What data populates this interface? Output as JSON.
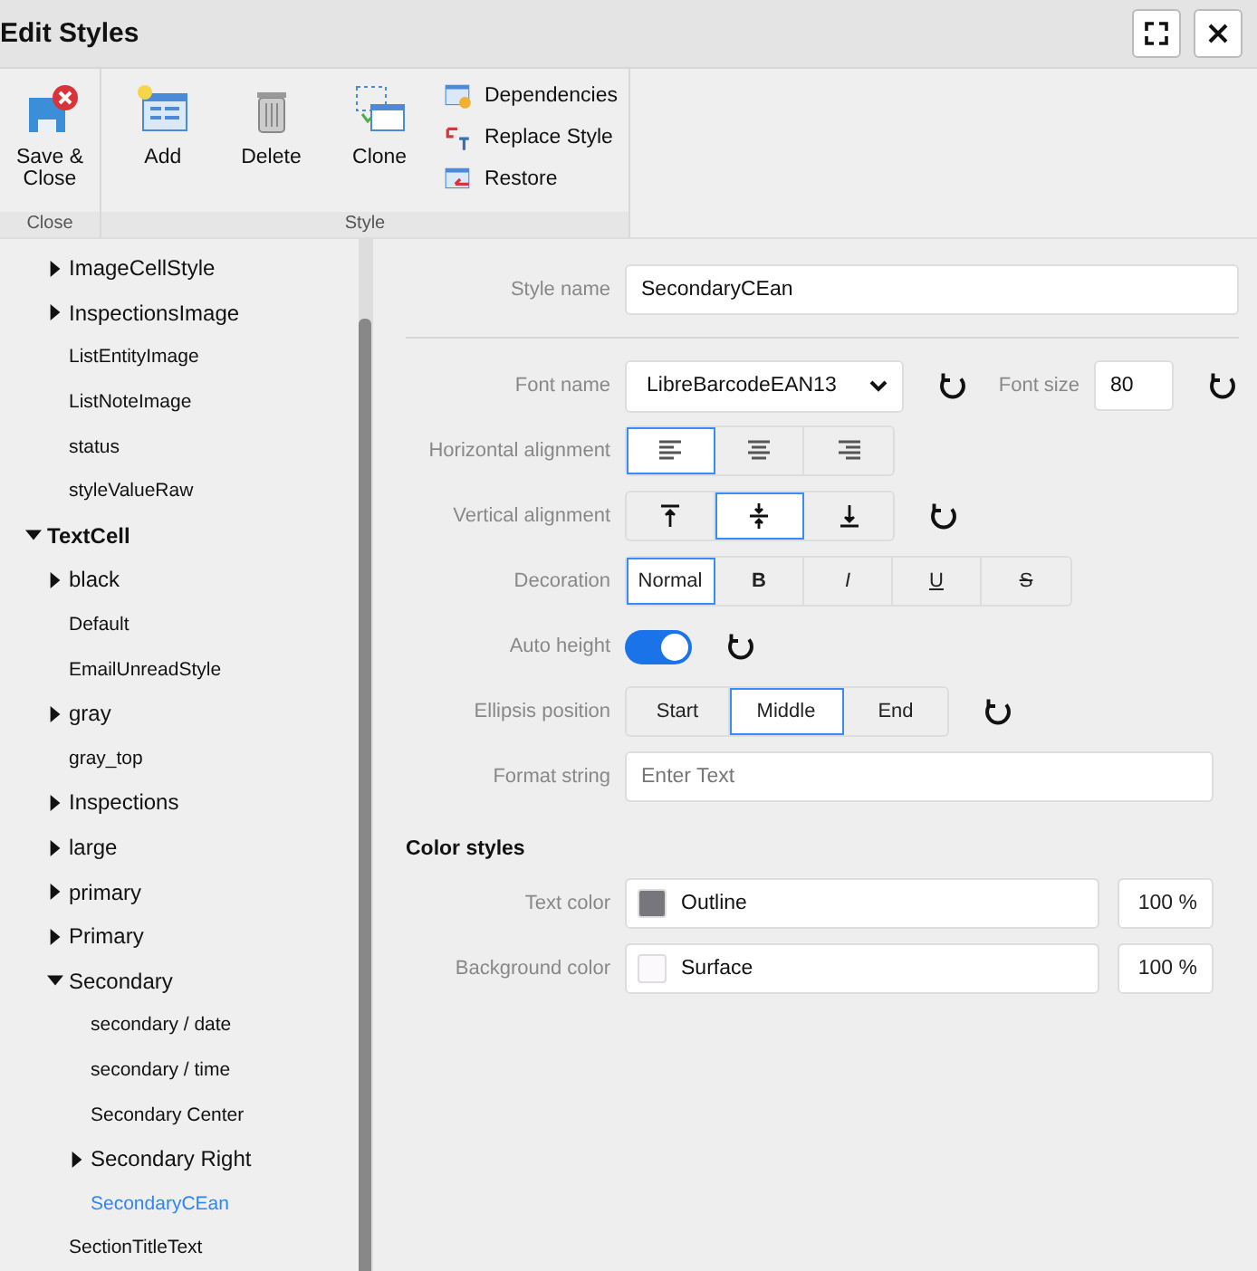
{
  "window": {
    "title": "Edit Styles"
  },
  "toolbar": {
    "groups": [
      {
        "label": "Close",
        "buttons": [
          {
            "label": "Save &\nClose",
            "kind": "save"
          }
        ]
      },
      {
        "label": "Style",
        "buttons": [
          {
            "label": "Add",
            "kind": "add"
          },
          {
            "label": "Delete",
            "kind": "delete"
          },
          {
            "label": "Clone",
            "kind": "clone"
          }
        ],
        "links": [
          {
            "label": "Dependencies",
            "kind": "dependencies"
          },
          {
            "label": "Replace Style",
            "kind": "replace"
          },
          {
            "label": "Restore",
            "kind": "restore"
          }
        ]
      }
    ]
  },
  "tree": [
    {
      "children": [
        {
          "label": "ImageCellStyle",
          "expanded": false,
          "selected": false
        },
        {
          "label": "InspectionsImage",
          "expanded": false,
          "selected": false
        },
        {
          "label": "ListEntityImage",
          "selected": false
        },
        {
          "label": "ListNoteImage",
          "selected": false
        },
        {
          "label": "status",
          "selected": false
        },
        {
          "label": "styleValueRaw",
          "selected": false
        }
      ]
    },
    {
      "label": "TextCell",
      "expanded": true,
      "selected": false,
      "children": [
        {
          "label": "black",
          "expanded": false,
          "selected": false
        },
        {
          "label": "Default",
          "selected": false
        },
        {
          "label": "EmailUnreadStyle",
          "selected": false
        },
        {
          "label": "gray",
          "expanded": false,
          "selected": false
        },
        {
          "label": "gray_top",
          "selected": false
        },
        {
          "label": "Inspections",
          "expanded": false,
          "selected": false
        },
        {
          "label": "large",
          "expanded": false,
          "selected": false
        },
        {
          "label": "primary",
          "expanded": false,
          "selected": false
        },
        {
          "label": "Primary",
          "expanded": false,
          "selected": false
        },
        {
          "label": "Secondary",
          "expanded": true,
          "selected": false,
          "children": [
            {
              "label": "secondary / date",
              "selected": false
            },
            {
              "label": "secondary / time",
              "selected": false
            },
            {
              "label": "Secondary Center",
              "selected": false
            },
            {
              "label": "Secondary Right",
              "expanded": false,
              "selected": false
            },
            {
              "label": "SecondaryCEan",
              "selected": true
            }
          ]
        },
        {
          "label": "SectionTitleText",
          "selected": false
        }
      ]
    }
  ],
  "form": {
    "style_name": {
      "label": "Style name",
      "value": "SecondaryCEan"
    },
    "font_name": {
      "label": "Font name",
      "value": "LibreBarcodeEAN13"
    },
    "font_size": {
      "label": "Font size",
      "value": "80"
    },
    "horizontal_alignment": {
      "label": "Horizontal alignment",
      "options": [
        {
          "kind": "left",
          "selected": true
        },
        {
          "kind": "center",
          "selected": false
        },
        {
          "kind": "right",
          "selected": false
        }
      ]
    },
    "vertical_alignment": {
      "label": "Vertical alignment",
      "options": [
        {
          "kind": "top",
          "selected": false
        },
        {
          "kind": "middle",
          "selected": true
        },
        {
          "kind": "bottom",
          "selected": false
        }
      ]
    },
    "decoration": {
      "label": "Decoration",
      "options": [
        {
          "label": "Normal",
          "kind": "normal",
          "selected": true
        },
        {
          "label": "B",
          "kind": "bold",
          "selected": false
        },
        {
          "label": "I",
          "kind": "italic",
          "selected": false
        },
        {
          "label": "U",
          "kind": "underline",
          "selected": false
        },
        {
          "label": "S",
          "kind": "strike",
          "selected": false
        }
      ]
    },
    "auto_height": {
      "label": "Auto height",
      "on": true
    },
    "ellipsis_position": {
      "label": "Ellipsis position",
      "options": [
        {
          "label": "Start",
          "selected": false
        },
        {
          "label": "Middle",
          "selected": true
        },
        {
          "label": "End",
          "selected": false
        }
      ]
    },
    "format_string": {
      "label": "Format string",
      "placeholder": "Enter Text"
    }
  },
  "color_styles": {
    "title": "Color styles",
    "rows": [
      {
        "label": "Text color",
        "value": "Outline",
        "color": "#76767c",
        "percent": "100 %"
      },
      {
        "label": "Background color",
        "value": "Surface",
        "color": "#fbf9fc",
        "percent": "100 %"
      }
    ]
  }
}
